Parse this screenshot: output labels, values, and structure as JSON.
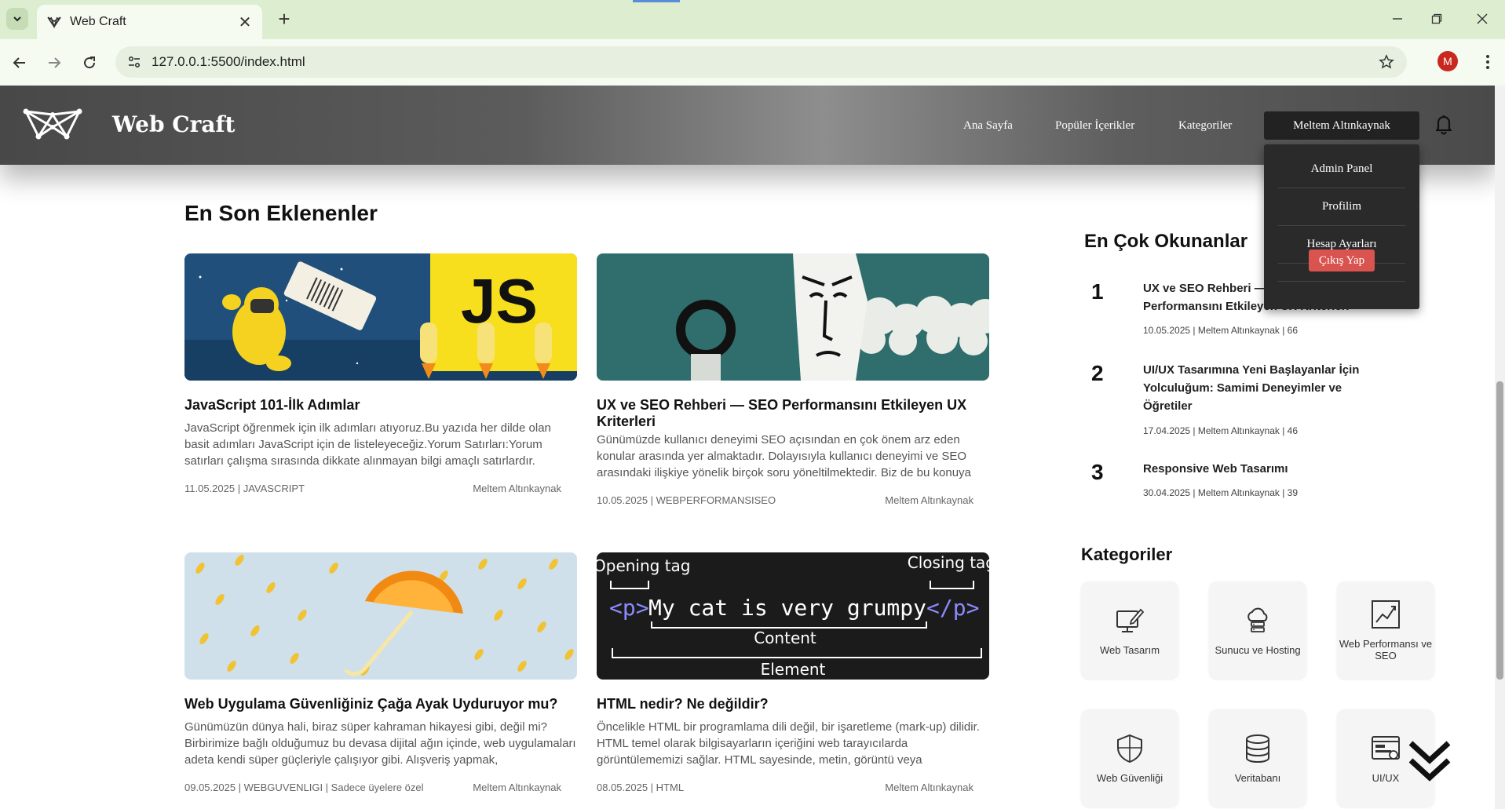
{
  "browser": {
    "tab_title": "Web Craft",
    "url": "127.0.0.1:5500/index.html",
    "profile_initial": "M",
    "icons": [
      "tab-search-icon",
      "close-icon",
      "plus-icon",
      "minimize-icon",
      "restore-icon",
      "close-window-icon",
      "back-arrow-icon",
      "forward-arrow-icon",
      "reload-icon",
      "site-info-icon",
      "star-icon",
      "kebab-menu-icon"
    ]
  },
  "header": {
    "site_title": "Web Craft",
    "nav": [
      "Ana Sayfa",
      "Popüler İçerikler",
      "Kategoriler"
    ],
    "user_name": "Meltem Altınkaynak",
    "dropdown": {
      "items": [
        "Admin Panel",
        "Profilim",
        "Hesap Ayarları"
      ],
      "logout": "Çıkış Yap"
    },
    "colors": {
      "header_gradient_mid": "#8e8e8e",
      "logout": "#d9534f",
      "dropdown_bg": "#2a2a2a"
    }
  },
  "latest": {
    "heading": "En Son Eklenenler",
    "cards": [
      {
        "title": "JavaScript 101-İlk Adımlar",
        "excerpt": "JavaScript öğrenmek için ilk adımları atıyoruz.Bu yazıda her dilde olan basit adımları JavaScript için de listeleyeceğiz.Yorum Satırları:Yorum satırları çalışma sırasında dikkate alınmayan bilgi amaçlı satırlardır.",
        "meta_left": "11.05.2025 | JAVASCRIPT",
        "author": "Meltem Altınkaynak",
        "image_text": "JS"
      },
      {
        "title": "UX ve SEO Rehberi — SEO Performansını Etkileyen UX Kriterleri",
        "excerpt": "Günümüzde kullanıcı deneyimi SEO açısından en çok önem arz eden konular arasında yer almaktadır. Dolayısıyla kullanıcı deneyimi ve SEO arasındaki ilişkiye yönelik birçok soru yöneltilmektedir. Biz de bu konuya",
        "meta_left": "10.05.2025 | WEBPERFORMANSISEO",
        "author": "Meltem Altınkaynak"
      },
      {
        "title": "Web Uygulama Güvenliğiniz Çağa Ayak Uyduruyor mu?",
        "excerpt": "Günümüzün dünya hali, biraz süper kahraman hikayesi gibi, değil mi? Birbirimize bağlı olduğumuz bu devasa dijital ağın içinde, web uygulamaları adeta kendi süper güçleriyle çalışıyor gibi. Alışveriş yapmak,",
        "meta_left": "09.05.2025 | WEBGUVENLIGI | Sadece üyelere özel",
        "author": "Meltem Altınkaynak"
      },
      {
        "title": "HTML nedir? Ne değildir?",
        "excerpt": "Öncelikle HTML bir programlama dili değil, bir işaretleme (mark-up) dilidir. HTML temel olarak bilgisayarların içeriğini web tarayıcılarda görüntülememizi sağlar. HTML sayesinde, metin, görüntü veya",
        "meta_left": "08.05.2025 | HTML",
        "author": "Meltem Altınkaynak",
        "image_labels": {
          "opening": "Opening tag",
          "closing": "Closing tag",
          "open_tag": "<p>",
          "code": "My cat is very grumpy",
          "close_tag": "</p>",
          "content": "Content",
          "element": "Element"
        }
      }
    ]
  },
  "popular": {
    "heading": "En Çok Okunanlar",
    "items": [
      {
        "rank": "1",
        "title": "UX ve SEO Rehberi — SEO Performansını Etkileyen UX Kriterleri",
        "meta": "10.05.2025 | Meltem Altınkaynak | 66"
      },
      {
        "rank": "2",
        "title": "UI/UX Tasarımına Yeni Başlayanlar İçin Yolculuğum: Samimi Deneyimler ve Öğretiler",
        "meta": "17.04.2025 | Meltem Altınkaynak | 46"
      },
      {
        "rank": "3",
        "title": "Responsive Web Tasarımı",
        "meta": "30.04.2025 | Meltem Altınkaynak | 39"
      }
    ]
  },
  "categories": {
    "heading": "Kategoriler",
    "items": [
      {
        "label": "Web Tasarım",
        "icon": "monitor-pen-icon"
      },
      {
        "label": "Sunucu ve Hosting",
        "icon": "cloud-server-icon"
      },
      {
        "label": "Web Performansı ve SEO",
        "icon": "chart-line-icon"
      },
      {
        "label": "Web Güvenliği",
        "icon": "shield-icon"
      },
      {
        "label": "Veritabanı",
        "icon": "database-icon"
      },
      {
        "label": "UI/UX",
        "icon": "ui-window-icon"
      }
    ]
  }
}
